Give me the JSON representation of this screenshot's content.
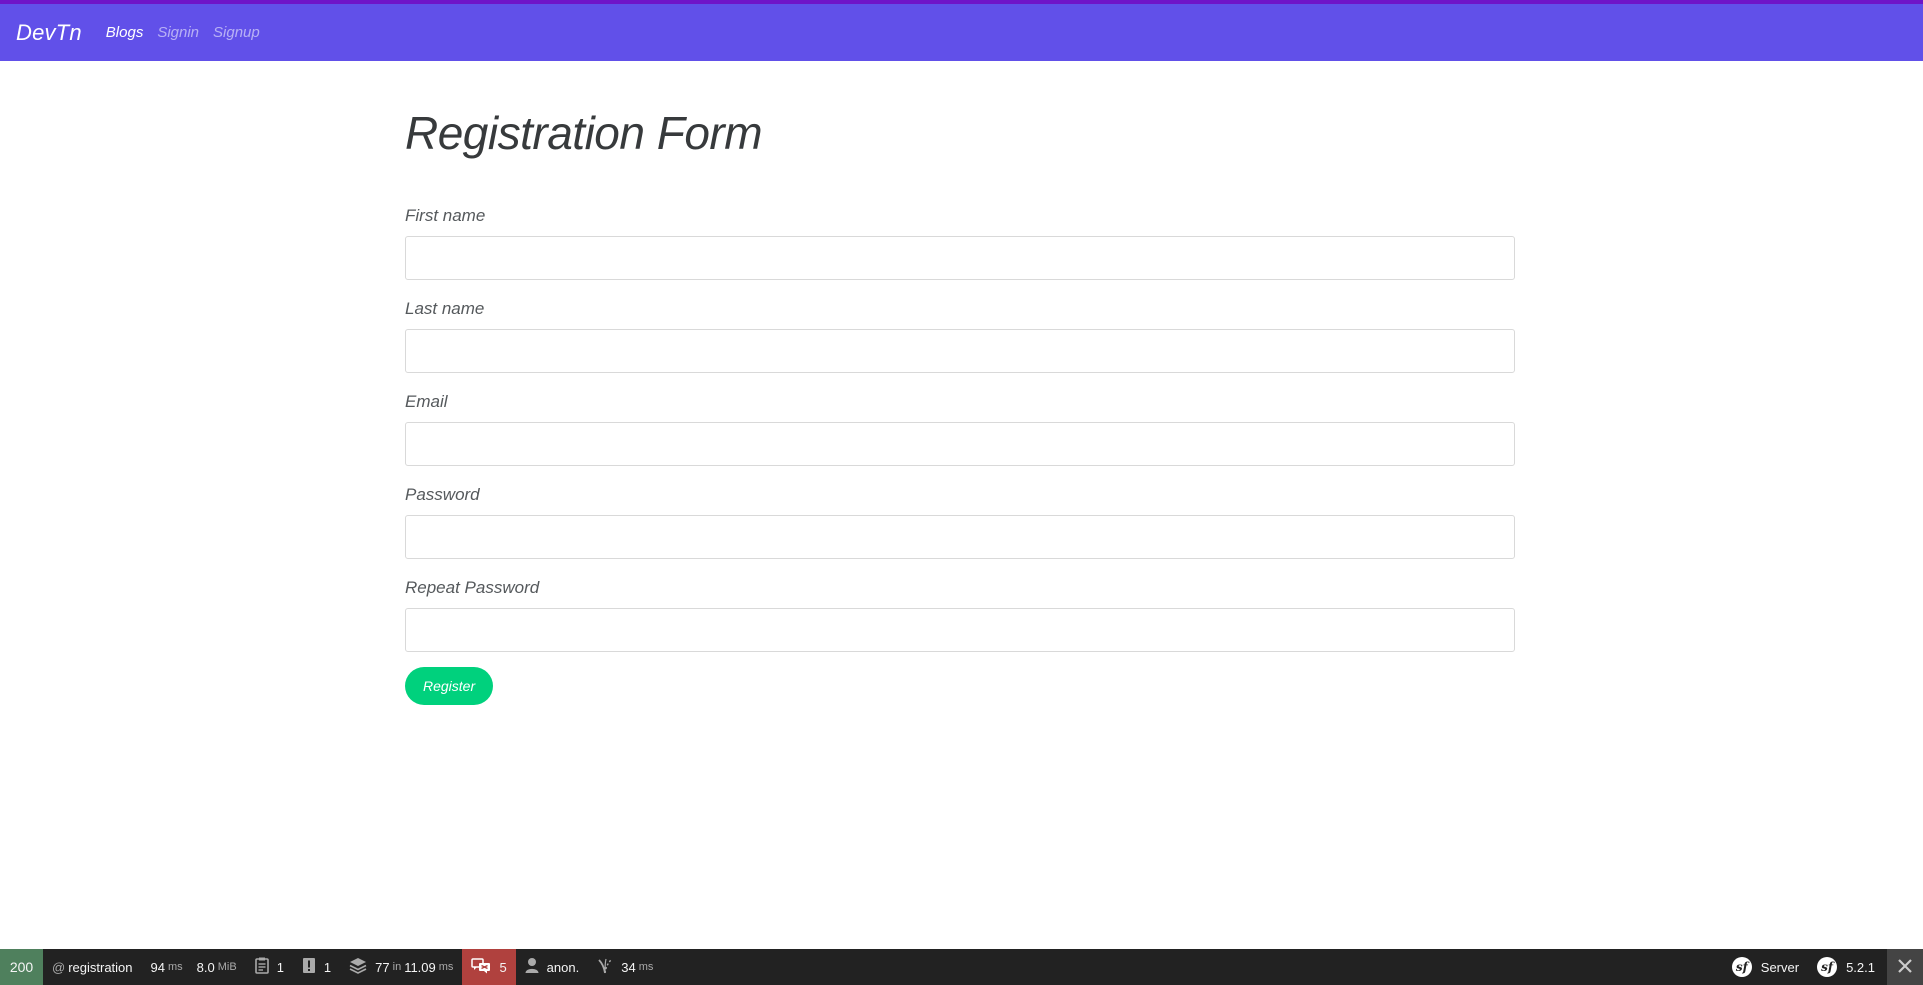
{
  "navbar": {
    "brand": "DevTn",
    "links": [
      {
        "label": "Blogs"
      },
      {
        "label": "Signin"
      },
      {
        "label": "Signup"
      }
    ]
  },
  "page": {
    "title": "Registration Form"
  },
  "form": {
    "fields": [
      {
        "label": "First name",
        "value": ""
      },
      {
        "label": "Last name",
        "value": ""
      },
      {
        "label": "Email",
        "value": ""
      },
      {
        "label": "Password",
        "value": ""
      },
      {
        "label": "Repeat Password",
        "value": ""
      }
    ],
    "submit_label": "Register"
  },
  "toolbar": {
    "status": "200",
    "route_at": "@",
    "route": "registration",
    "time_value": "94",
    "time_unit": "ms",
    "memory_value": "8.0",
    "memory_unit": "MiB",
    "logs_count": "1",
    "warnings_count": "1",
    "twig_count": "77",
    "twig_in": "in",
    "twig_time": "11.09",
    "twig_unit": "ms",
    "translation_errors": "5",
    "user": "anon.",
    "ajax_time": "34",
    "ajax_unit": "ms",
    "server_label": "Server",
    "symfony_version": "5.2.1",
    "colors": {
      "status_ok": "#4f805d",
      "error": "#b0413e",
      "background": "#222222"
    }
  },
  "colors": {
    "navbar": "#6150e9",
    "navbar_top_border": "#6f14c8",
    "register_button": "#00d17d"
  }
}
